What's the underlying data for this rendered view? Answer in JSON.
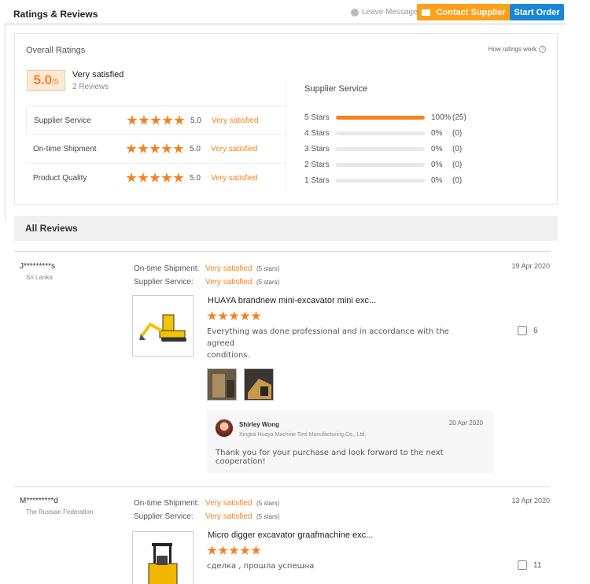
{
  "header": {
    "title": "Ratings & Reviews",
    "leave_messages": "Leave Messages",
    "contact_supplier": "Contact Supplier",
    "start_order": "Start Order"
  },
  "overall": {
    "title": "Overall Ratings",
    "how_ratings_work": "How ratings work",
    "score": "5.0",
    "score_max": "/5",
    "satisfaction": "Very satisfied",
    "review_count": "2 Reviews",
    "dimensions": [
      {
        "label": "Supplier Service",
        "value": "5.0",
        "satisfaction": "Very satisfied",
        "stars": 5
      },
      {
        "label": "On-time Shipment",
        "value": "5.0",
        "satisfaction": "Very satisfied",
        "stars": 5
      },
      {
        "label": "Product Quality",
        "value": "5.0",
        "satisfaction": "Very satisfied",
        "stars": 5
      }
    ]
  },
  "supplier_service": {
    "title": "Supplier Service",
    "rows": [
      {
        "label": "5 Stars",
        "percent": "100%",
        "count": "(25)",
        "fill_pct": 100
      },
      {
        "label": "4 Stars",
        "percent": "0%",
        "count": "(0)",
        "fill_pct": 0
      },
      {
        "label": "3 Stars",
        "percent": "0%",
        "count": "(0)",
        "fill_pct": 0
      },
      {
        "label": "2 Stars",
        "percent": "0%",
        "count": "(0)",
        "fill_pct": 0
      },
      {
        "label": "1 Stars",
        "percent": "0%",
        "count": "(0)",
        "fill_pct": 0
      }
    ]
  },
  "all_reviews": {
    "title": "All Reviews",
    "reviews": [
      {
        "name": "J*********s",
        "country": "Sri Lanka",
        "date": "19 Apr 2020",
        "shipment_label": "On-time Shipment:",
        "shipment_value": "Very satisfied",
        "shipment_stars": "(5 stars)",
        "service_label": "Supplier Service:",
        "service_value": "Very satisfied",
        "service_stars": "(5 stars)",
        "product_title": "HUAYA brandnew mini-excavator mini exc...",
        "text_line1": "Everything was done professional and in accordance with the agreed",
        "text_line2": "conditions.",
        "likes": "6",
        "reply": {
          "name": "Shirley Wong",
          "company": "Xingtai Huaya Machine Tool Manufacturing Co., Ltd.",
          "date": "20 Apr 2020",
          "message": "Thank you for your purchase and look forward to the next cooperation!"
        }
      },
      {
        "name": "M*********d",
        "country": "The Russian Federation",
        "date": "13 Apr 2020",
        "shipment_label": "On-time Shipment:",
        "shipment_value": "Very satisfied",
        "shipment_stars": "(5 stars)",
        "service_label": "Supplier Service:",
        "service_value": "Very satisfied",
        "service_stars": "(5 stars)",
        "product_title": "Micro digger excavator graafmachine exc...",
        "text_line1": "сделка , прошла успешна",
        "likes": "11"
      }
    ]
  },
  "colors": {
    "accent": "#f5821f",
    "contact_btn": "#ff9f1a",
    "order_btn": "#1a87d6"
  }
}
